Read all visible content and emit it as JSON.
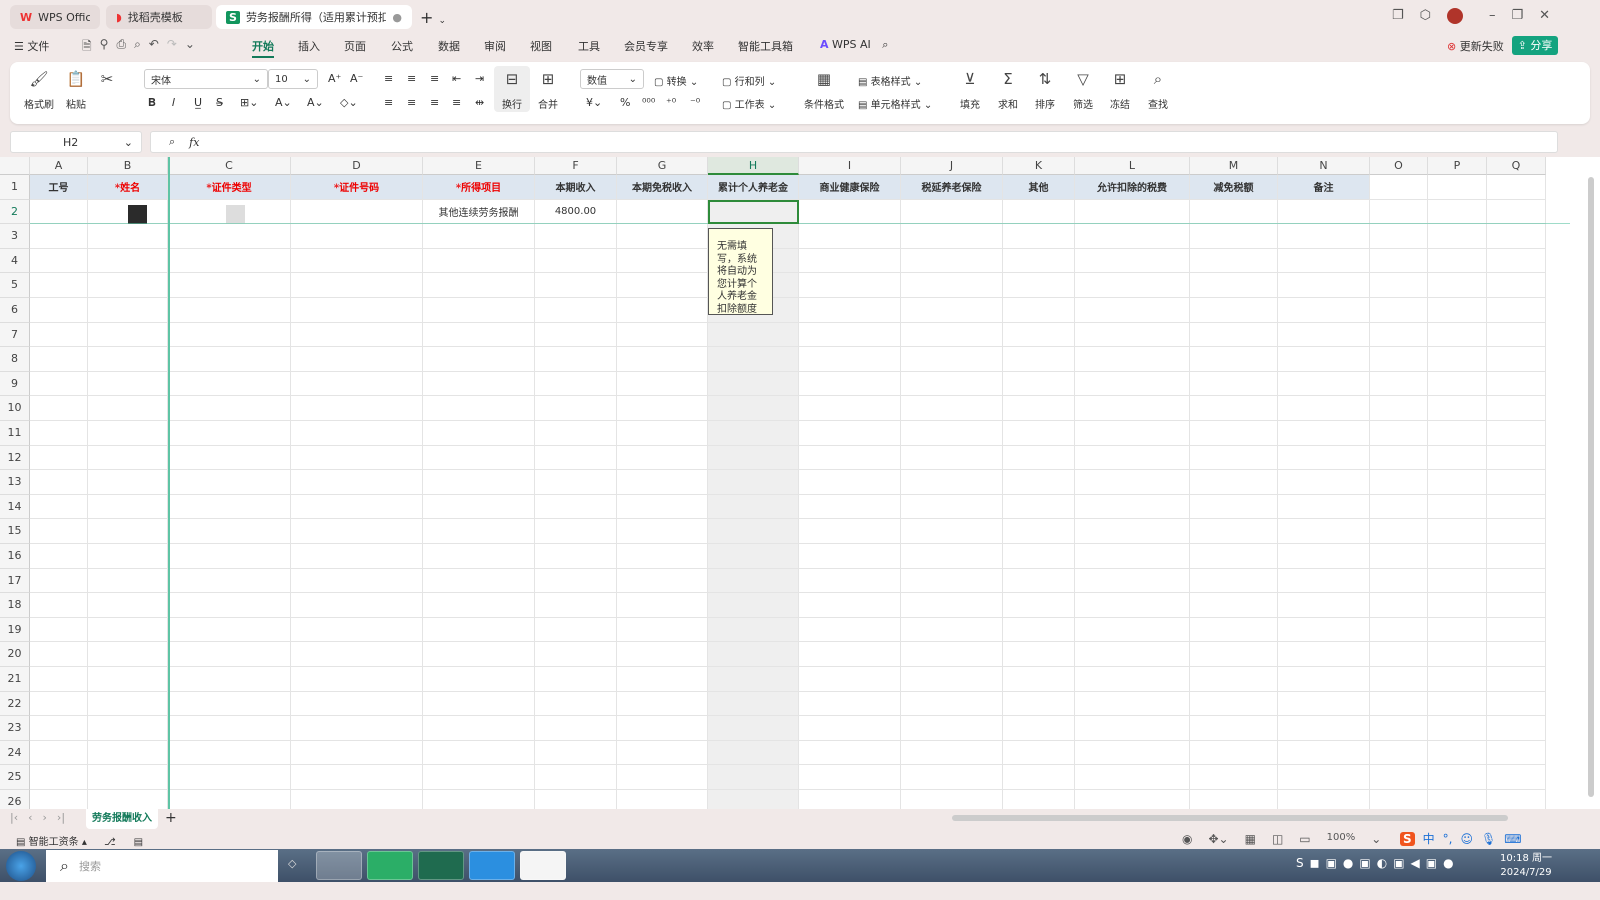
{
  "window": {
    "tabs": [
      {
        "label": "WPS Office",
        "icon": "wps-logo-icon"
      },
      {
        "label": "找稻壳模板",
        "icon": "docer-icon"
      },
      {
        "label": "劳务报酬所得（适用累计预扣法",
        "icon": "spreadsheet-s-icon",
        "active": true
      }
    ],
    "update_status": "更新失败",
    "share_label": "分享"
  },
  "menu": {
    "items": [
      "☰ 文件",
      "开始",
      "插入",
      "页面",
      "公式",
      "数据",
      "审阅",
      "视图",
      "工具",
      "会员专享",
      "效率",
      "智能工具箱"
    ],
    "active": "开始",
    "wps_ai": "WPS AI"
  },
  "ribbon": {
    "format_painter": "格式刷",
    "paste": "粘贴",
    "font": "宋体",
    "font_size": "10",
    "wrap": "换行",
    "merge": "合并",
    "number_format": "数值",
    "convert": "转换",
    "rows_cols": "行和列",
    "worksheet": "工作表",
    "cond_format": "条件格式",
    "table_style": "表格样式",
    "cell_style": "单元格样式",
    "fill": "填充",
    "sum": "求和",
    "sort": "排序",
    "filter": "筛选",
    "freeze": "冻结",
    "find": "查找"
  },
  "formula_bar": {
    "name_box": "H2",
    "fx": "fx",
    "value": ""
  },
  "sheet": {
    "columns": [
      "A",
      "B",
      "C",
      "D",
      "E",
      "F",
      "G",
      "H",
      "I",
      "J",
      "K",
      "L",
      "M",
      "N",
      "O",
      "P",
      "Q"
    ],
    "header_row": [
      {
        "text": "工号"
      },
      {
        "text": "*姓名",
        "required": true
      },
      {
        "text": "*证件类型",
        "required": true
      },
      {
        "text": "*证件号码",
        "required": true
      },
      {
        "text": "*所得项目",
        "required": true
      },
      {
        "text": "本期收入"
      },
      {
        "text": "本期免税收入"
      },
      {
        "text": "累计个人养老金"
      },
      {
        "text": "商业健康保险"
      },
      {
        "text": "税延养老保险"
      },
      {
        "text": "其他"
      },
      {
        "text": "允许扣除的税费"
      },
      {
        "text": "减免税额"
      },
      {
        "text": "备注"
      }
    ],
    "row2": {
      "E": "其他连续劳务报酬",
      "F": "4800.00"
    },
    "selected_cell": "H2",
    "note": "无需填写，系统将自动为您计算个人养老金扣除额度",
    "tab": "劳务报酬收入",
    "header_color": "#dde6f0",
    "selection_color": "#2e8b3a"
  },
  "statusbar": {
    "smart_payroll": "智能工资条",
    "zoom": "100%"
  },
  "taskbar": {
    "search_placeholder": "搜索",
    "time": "10:18 周一",
    "date": "2024/7/29",
    "ime": "中"
  }
}
